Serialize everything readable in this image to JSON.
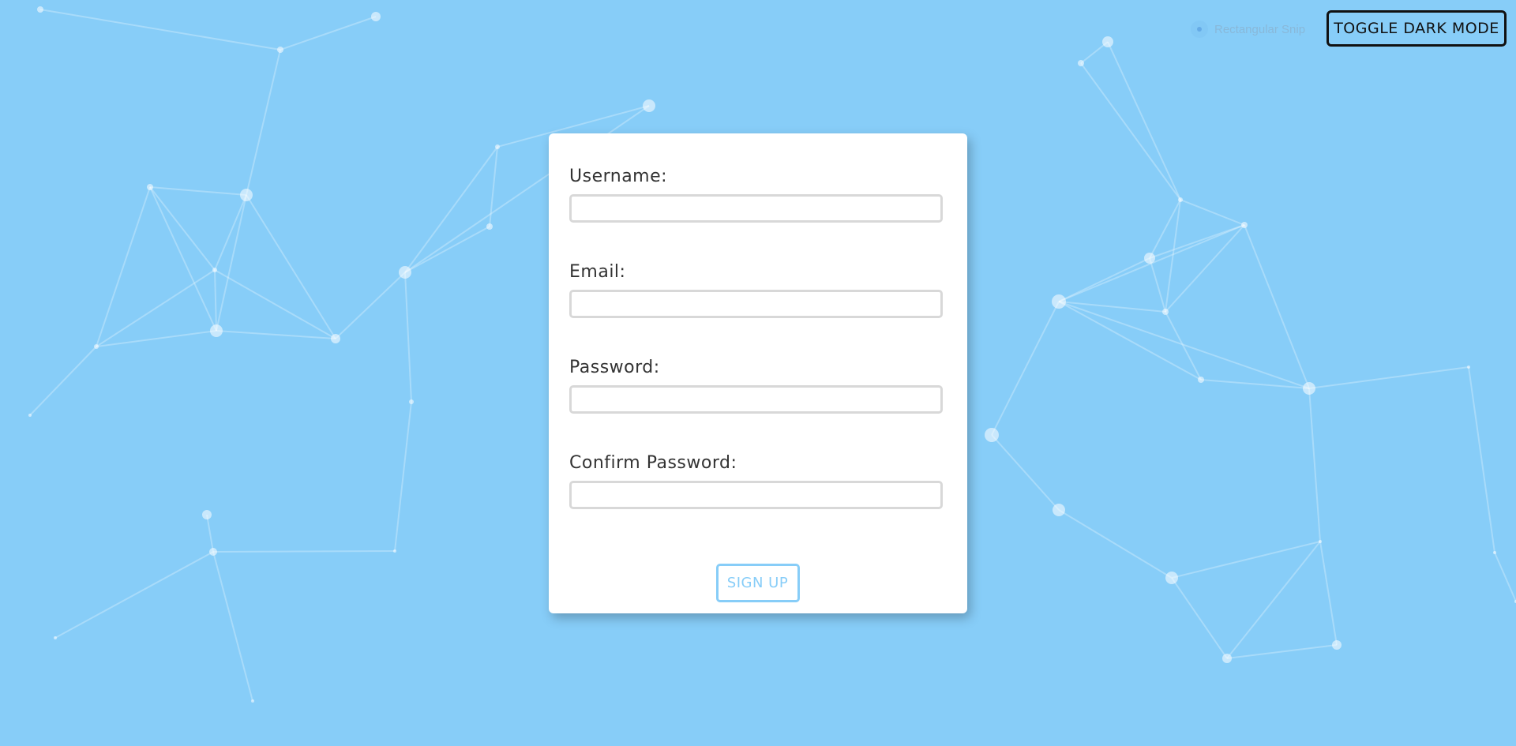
{
  "header": {
    "snip_label": "Rectangular Snip",
    "dark_mode_label": "TOGGLE DARK MODE"
  },
  "form": {
    "fields": [
      {
        "label": "Username:",
        "value": "",
        "placeholder": ""
      },
      {
        "label": "Email:",
        "value": "",
        "placeholder": ""
      },
      {
        "label": "Password:",
        "value": "",
        "placeholder": ""
      },
      {
        "label": "Confirm Password:",
        "value": "",
        "placeholder": ""
      }
    ],
    "submit_label": "SIGN UP"
  },
  "colors": {
    "background": "#87cdf8",
    "card": "#ffffff",
    "accent": "#87cdf8",
    "text": "#333333"
  }
}
